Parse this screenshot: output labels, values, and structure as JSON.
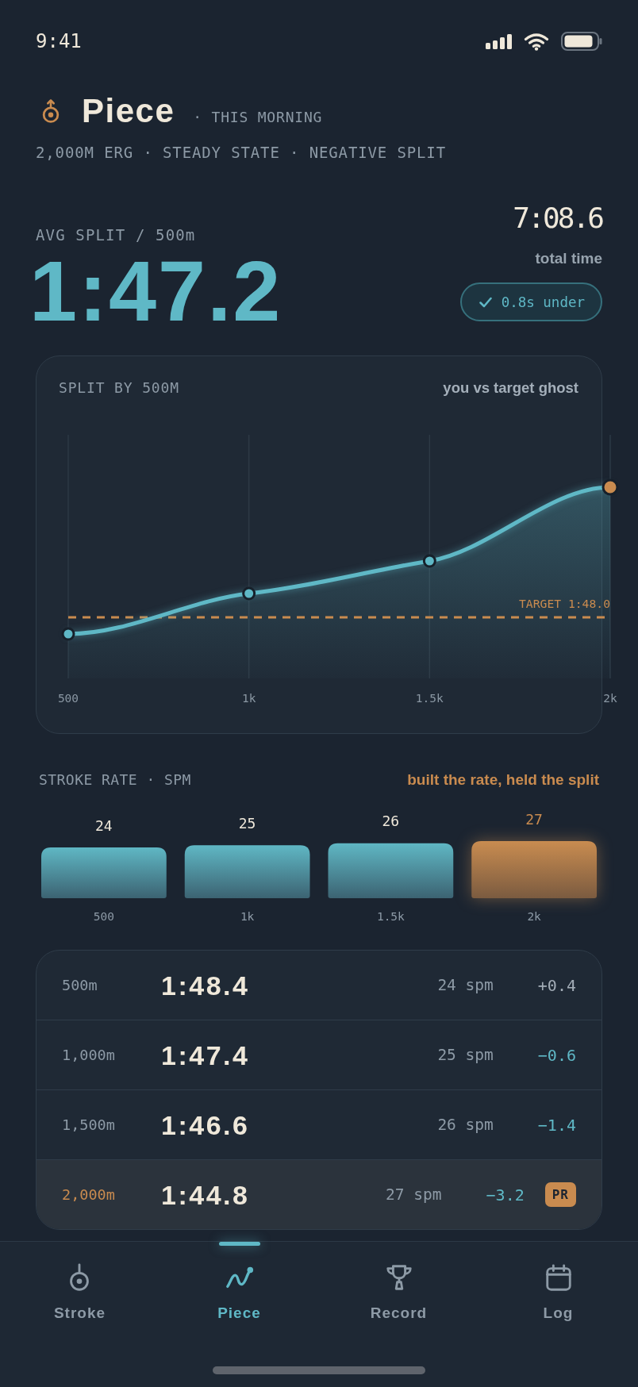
{
  "status_bar": {
    "time": "9:41"
  },
  "header": {
    "title": "Piece",
    "when": "· THIS MORNING",
    "subtitle": "2,000M ERG · STEADY STATE · NEGATIVE SPLIT"
  },
  "summary": {
    "avg_split_label": "AVG SPLIT / 500m",
    "avg_split": "1:47.2",
    "total_time": "7:08.6",
    "total_time_label": "total time",
    "target_badge": "0.8s under"
  },
  "split_chart": {
    "title": "SPLIT BY 500M",
    "note": "you vs target ghost",
    "target_label": "TARGET 1:48.0",
    "x_points": [
      {
        "label": "500",
        "highlighted": false
      },
      {
        "label": "1k",
        "highlighted": false
      },
      {
        "label": "1.5k",
        "highlighted": false
      },
      {
        "label": "2k",
        "highlighted": true
      }
    ]
  },
  "stroke_rate": {
    "title": "STROKE RATE · SPM",
    "note": "built the rate, held the split",
    "highlighted_bars": [
      false,
      false,
      false,
      true
    ],
    "chart_data": {
      "type": "bar",
      "categories": [
        "500",
        "1k",
        "1.5k",
        "2k"
      ],
      "values": [
        24,
        25,
        26,
        27
      ],
      "data_labels": true
    }
  },
  "splits_table": {
    "rows": [
      {
        "distance": "500m",
        "split": "1:48.4",
        "rate": "24 spm",
        "delta": "+0.4",
        "under_target": false,
        "highlighted": false
      },
      {
        "distance": "1,000m",
        "split": "1:47.4",
        "rate": "25 spm",
        "delta": "−0.6",
        "under_target": true,
        "highlighted": false
      },
      {
        "distance": "1,500m",
        "split": "1:46.6",
        "rate": "26 spm",
        "delta": "−1.4",
        "under_target": true,
        "highlighted": false
      },
      {
        "distance": "2,000m",
        "split": "1:44.8",
        "rate": "27 spm",
        "delta": "−3.2",
        "under_target": true,
        "highlighted": true,
        "badge": "PR"
      }
    ]
  },
  "tabs": [
    {
      "label": "Stroke",
      "selected": false
    },
    {
      "label": "Piece",
      "selected": true
    },
    {
      "label": "Record",
      "selected": false
    },
    {
      "label": "Log",
      "selected": false
    }
  ]
}
